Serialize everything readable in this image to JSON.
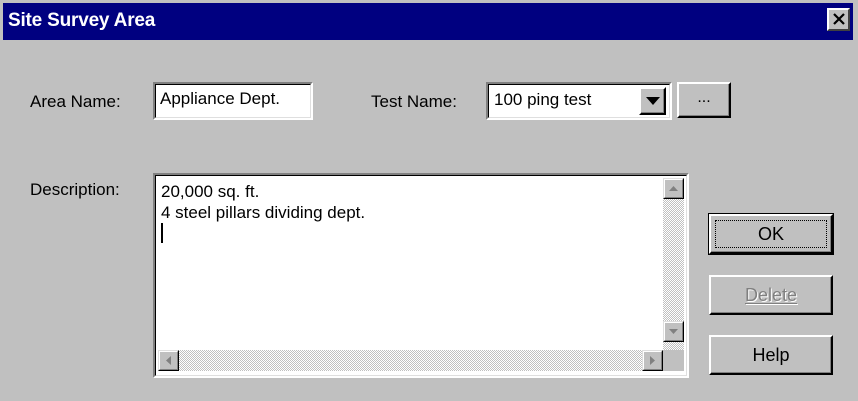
{
  "window": {
    "title": "Site Survey Area",
    "close_icon": "close-icon"
  },
  "form": {
    "area_name_label": "Area Name:",
    "area_name_value": "Appliance Dept.",
    "test_name_label": "Test Name:",
    "test_name_value": "100 ping test",
    "browse_label": "...",
    "description_label": "Description:",
    "description_lines": [
      "20,000 sq. ft.",
      "4 steel pillars dividing dept."
    ]
  },
  "buttons": {
    "ok": "OK",
    "delete": "Delete",
    "help": "Help"
  },
  "colors": {
    "titlebar": "#000080",
    "face": "#c0c0c0"
  }
}
